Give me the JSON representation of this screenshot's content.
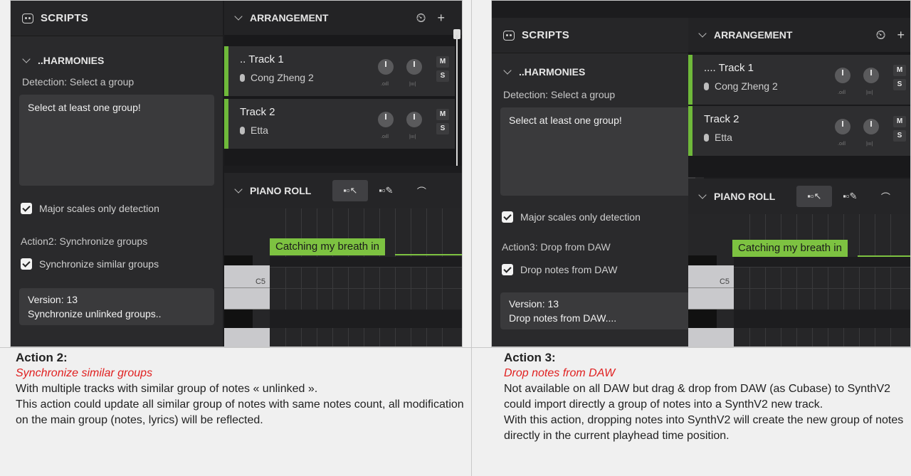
{
  "left": {
    "scripts_title": "SCRIPTS",
    "section": "..HARMONIES",
    "detection": "Detection: Select a group",
    "textbox": "Select at least one group!",
    "major_scales": "Major scales only detection",
    "action_label": "Action2: Synchronize groups",
    "action_check": "Synchronize similar groups",
    "version": "Version: 13",
    "version_status": "Synchronize unlinked groups..",
    "arrangement": "ARRANGEMENT",
    "tracks": [
      {
        "name": ".. Track 1",
        "singer": "Cong Zheng 2",
        "mute": "M",
        "solo": "S"
      },
      {
        "name": "Track 2",
        "singer": "Etta",
        "mute": "M",
        "solo": "S"
      }
    ],
    "piano_roll": "PIANO ROLL",
    "note": "Catching my breath in",
    "key_label": "C5"
  },
  "right": {
    "scripts_title": "SCRIPTS",
    "section": "..HARMONIES",
    "detection": "Detection: Select a group",
    "textbox": "Select at least one group!",
    "major_scales": "Major scales only detection",
    "action_label": "Action3: Drop from DAW",
    "action_check": "Drop notes from DAW",
    "version": "Version: 13",
    "version_status": "Drop notes from DAW....",
    "arrangement": "ARRANGEMENT",
    "tracks": [
      {
        "name": ".... Track 1",
        "singer": "Cong Zheng 2",
        "mute": "M",
        "solo": "S"
      },
      {
        "name": "Track 2",
        "singer": "Etta",
        "mute": "M",
        "solo": "S"
      }
    ],
    "piano_roll": "PIANO ROLL",
    "note": "Catching my breath in",
    "key_label": "C5"
  },
  "knob_labels": {
    "vol": ".oıll",
    "pan": "|ııı|"
  },
  "captions": {
    "left": {
      "title": "Action 2:",
      "subtitle": "Synchronize similar groups",
      "body": [
        "With multiple tracks with similar group of notes « unlinked ».",
        "This action could update all similar group of notes with same notes count, all modification on the main group (notes, lyrics) will be reflected."
      ]
    },
    "right": {
      "title": "Action 3:",
      "subtitle": "Drop notes from DAW",
      "body": [
        "Not available on all DAW but drag & drop from DAW (as Cubase) to SynthV2 could import directly a group of notes into a SynthV2 new track.",
        "With this action, dropping notes into SynthV2 will create the new group of notes directly in the current playhead time position."
      ]
    }
  }
}
